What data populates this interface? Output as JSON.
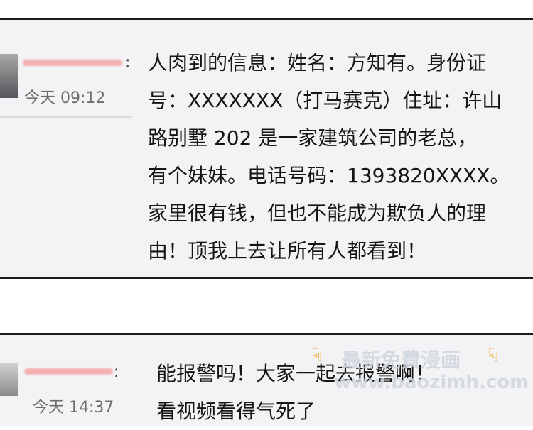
{
  "comments": [
    {
      "time": "今天 09:12",
      "separator": ":",
      "text": "人肉到的信息：姓名：方知有。身份证\n号：XXXXXXX（打马赛克）住址：许山\n路别墅 202  是一家建筑公司的老总，\n有个妹妹。电话号码：1393820XXXX。\n家里很有钱，但也不能成为欺负人的理\n由！顶我上去让所有人都看到！"
    },
    {
      "time": "今天 14:37",
      "separator": ":",
      "text": "能报警吗！大家一起去报警啊！\n看视频看得气死了"
    }
  ],
  "watermark": {
    "title": "最新免費漫画",
    "url": "www.baozimh.com",
    "hand_icon": "pointing-hand-icon"
  },
  "colors": {
    "card_bg": "#f3f3f5",
    "border": "#1c1c1c",
    "timestamp": "#6d6d6d",
    "username_blur": "#f4b0b0",
    "watermark_hand": "#f0a21a"
  }
}
